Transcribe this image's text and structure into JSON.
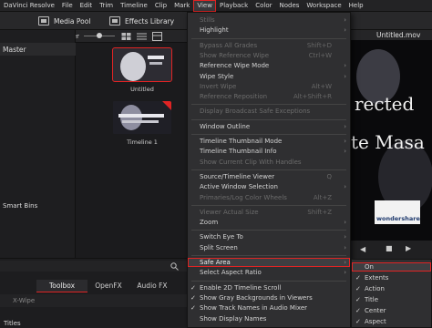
{
  "menubar": {
    "items": [
      "DaVinci Resolve",
      "File",
      "Edit",
      "Trim",
      "Timeline",
      "Clip",
      "Mark",
      "View",
      "Playback",
      "Color",
      "Nodes",
      "Workspace",
      "Help"
    ],
    "active": "View"
  },
  "toolbar": {
    "media_pool": "Media Pool",
    "effects_library": "Effects Library"
  },
  "media_pool": {
    "folder": "Master",
    "sidebar_title": "Master",
    "smart_bins": "Smart Bins",
    "clips": [
      {
        "name": "Untitled"
      },
      {
        "name": "Timeline 1"
      }
    ]
  },
  "viewer": {
    "title": "Untitled.mov",
    "text_line1": "rected",
    "text_line2": "te Masa",
    "watermark": "wondershare"
  },
  "bottom_tabs": [
    "Toolbox",
    "OpenFX",
    "Audio FX"
  ],
  "bottom_items": [
    "X-Wipe",
    "Titles"
  ],
  "view_menu": {
    "items": [
      {
        "label": "Stills",
        "enabled": false,
        "arrow": true
      },
      {
        "label": "Highlight",
        "enabled": true,
        "arrow": true
      },
      {
        "label": "Bypass All Grades",
        "enabled": false,
        "shortcut": "Shift+D"
      },
      {
        "label": "Show Reference Wipe",
        "enabled": false,
        "shortcut": "Ctrl+W"
      },
      {
        "label": "Reference Wipe Mode",
        "enabled": true,
        "arrow": true
      },
      {
        "label": "Wipe Style",
        "enabled": true,
        "arrow": true
      },
      {
        "label": "Invert Wipe",
        "enabled": false,
        "shortcut": "Alt+W"
      },
      {
        "label": "Reference Reposition",
        "enabled": false,
        "shortcut": "Alt+Shift+R"
      },
      {
        "label": "Display Broadcast Safe Exceptions",
        "enabled": false
      },
      {
        "label": "Window Outline",
        "enabled": true,
        "arrow": true
      },
      {
        "label": "Timeline Thumbnail Mode",
        "enabled": true,
        "arrow": true
      },
      {
        "label": "Timeline Thumbnail Info",
        "enabled": true,
        "arrow": true
      },
      {
        "label": "Show Current Clip With Handles",
        "enabled": false
      },
      {
        "label": "Source/Timeline Viewer",
        "enabled": true,
        "shortcut": "Q"
      },
      {
        "label": "Active Window Selection",
        "enabled": true,
        "arrow": true
      },
      {
        "label": "Primaries/Log Color Wheels",
        "enabled": false,
        "shortcut": "Alt+Z"
      },
      {
        "label": "Viewer Actual Size",
        "enabled": false,
        "shortcut": "Shift+Z"
      },
      {
        "label": "Zoom",
        "enabled": true,
        "arrow": true
      },
      {
        "label": "Switch Eye To",
        "enabled": true,
        "arrow": true
      },
      {
        "label": "Split Screen",
        "enabled": true,
        "arrow": true
      },
      {
        "label": "Safe Area",
        "enabled": true,
        "arrow": true,
        "highlighted": true
      },
      {
        "label": "Select Aspect Ratio",
        "enabled": true,
        "arrow": true
      },
      {
        "label": "Enable 2D Timeline Scroll",
        "enabled": true,
        "checked": true
      },
      {
        "label": "Show Gray Backgrounds in Viewers",
        "enabled": true,
        "checked": true
      },
      {
        "label": "Show Track Names in Audio Mixer",
        "enabled": true,
        "checked": true
      },
      {
        "label": "Show Display Names",
        "enabled": true
      }
    ]
  },
  "safe_area_submenu": {
    "items": [
      {
        "label": "On",
        "checked": false,
        "highlighted": true
      },
      {
        "label": "Extents",
        "checked": true
      },
      {
        "label": "Action",
        "checked": true
      },
      {
        "label": "Title",
        "checked": true
      },
      {
        "label": "Center",
        "checked": true
      },
      {
        "label": "Aspect",
        "checked": true
      }
    ]
  },
  "colors": {
    "accent_red": "#e02424",
    "menu_bg": "#2f2f31",
    "app_bg": "#1b1b1d"
  }
}
